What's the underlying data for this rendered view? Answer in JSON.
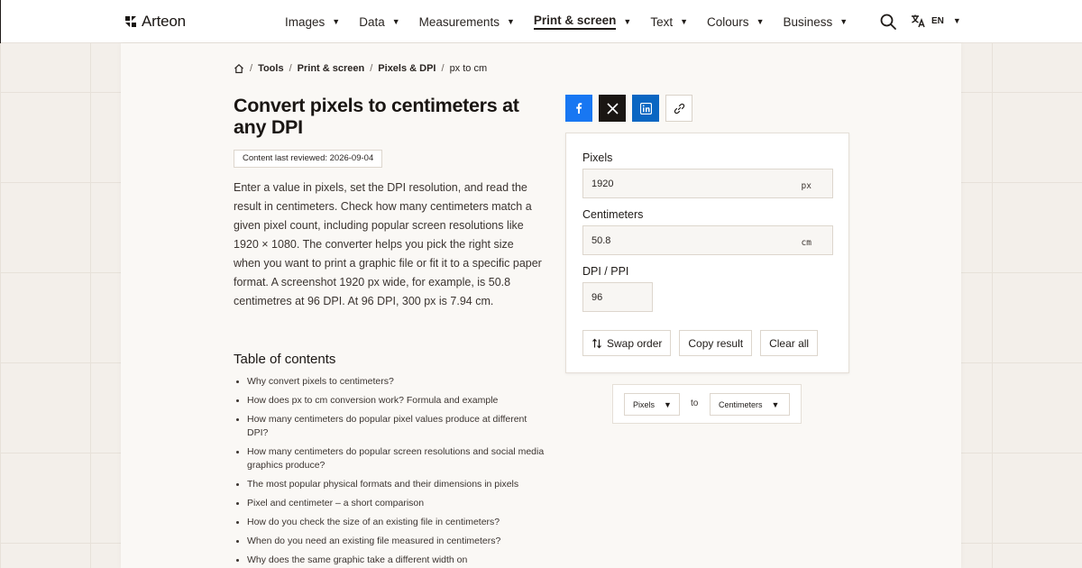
{
  "brand": {
    "name": "Arteon"
  },
  "nav": [
    {
      "label": "Images",
      "active": false
    },
    {
      "label": "Data",
      "active": false
    },
    {
      "label": "Measurements",
      "active": false
    },
    {
      "label": "Print & screen",
      "active": true
    },
    {
      "label": "Text",
      "active": false
    },
    {
      "label": "Colours",
      "active": false
    },
    {
      "label": "Business",
      "active": false
    }
  ],
  "language": {
    "code": "EN",
    "icon": "translate-icon"
  },
  "icons": {
    "search": "search-icon",
    "home": "home-icon",
    "caret": "▼"
  },
  "breadcrumb": {
    "items": [
      "Tools",
      "Print & screen",
      "Pixels & DPI"
    ],
    "current": "px to cm"
  },
  "page": {
    "title": "Convert pixels to centimeters at any DPI",
    "reviewed": "Content last reviewed: 2026-09-04",
    "intro": "Enter a value in pixels, set the DPI resolution, and read the result in centimeters. Check how many centimeters match a given pixel count, including popular screen resolutions like 1920 × 1080. The converter helps you pick the right size when you want to print a graphic file or fit it to a specific paper format. A screenshot 1920 px wide, for example, is 50.8 centimetres at 96 DPI. At 96 DPI, 300 px is 7.94 cm."
  },
  "toc": {
    "title": "Table of contents",
    "items": [
      "Why convert pixels to centimeters?",
      "How does px to cm conversion work? Formula and example",
      "How many centimeters do popular pixel values produce at different DPI?",
      "How many centimeters do popular screen resolutions and social media graphics produce?",
      "The most popular physical formats and their dimensions in pixels",
      "Pixel and centimeter – a short comparison",
      "How do you check the size of an existing file in centimeters?",
      "When do you need an existing file measured in centimeters?",
      "Why does the same graphic take a different width on"
    ]
  },
  "share": [
    {
      "icon": "facebook-icon",
      "color": "#1877f2"
    },
    {
      "icon": "x-icon",
      "color": "#1a1613"
    },
    {
      "icon": "linkedin-icon",
      "color": "#0a66c2"
    },
    {
      "icon": "link-icon",
      "color": "#ffffff"
    }
  ],
  "converter": {
    "pixels": {
      "label": "Pixels",
      "value": "1920",
      "unit": "px"
    },
    "centimeters": {
      "label": "Centimeters",
      "value": "50.8",
      "unit": "cm"
    },
    "dpi": {
      "label": "DPI / PPI",
      "value": "96"
    },
    "buttons": {
      "swap": "Swap order",
      "copy": "Copy result",
      "clear": "Clear all"
    }
  },
  "units": {
    "from": "Pixels",
    "to_label": "to",
    "to": "Centimeters"
  }
}
